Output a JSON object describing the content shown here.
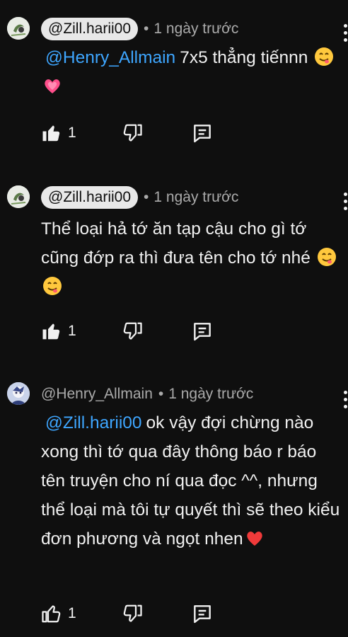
{
  "comments": [
    {
      "author": "@Zill.harii00",
      "author_style": "chip",
      "time": "1 ngày trước",
      "mention": "@Henry_Allmain",
      "text": "7x5 thẳng tiếnnn",
      "emojis": [
        "yum-emoji",
        "growing-heart-emoji"
      ],
      "likes": "1"
    },
    {
      "author": "@Zill.harii00",
      "author_style": "chip",
      "time": "1 ngày trước",
      "mention": "",
      "text": "Thể loại hả tớ ăn tạp cậu cho gì tớ cũng đớp ra thì đưa tên cho tớ nhé",
      "emojis": [
        "yum-emoji",
        "yum-emoji"
      ],
      "likes": "1"
    },
    {
      "author": "@Henry_Allmain",
      "author_style": "plain",
      "time": "1 ngày trước",
      "mention": "@Zill.harii00",
      "text": "ok vậy đợi chừng nào xong thì tớ qua đây thông báo r báo tên truyện cho ní qua đọc ^^, nhưng thể loại mà tôi tự quyết thì sẽ theo kiểu đơn phương và ngọt nhen",
      "emojis": [
        "red-heart-emoji"
      ],
      "likes": "1"
    }
  ],
  "separator": "•",
  "colors": {
    "background": "#0f0f0f",
    "text": "#f1f1f1",
    "muted": "#aaaaaa",
    "mention": "#3ea6ff",
    "chip": "#e8e8e8"
  },
  "icons": [
    "thumb-up-icon",
    "thumb-down-icon",
    "reply-icon",
    "more-vert-icon"
  ]
}
